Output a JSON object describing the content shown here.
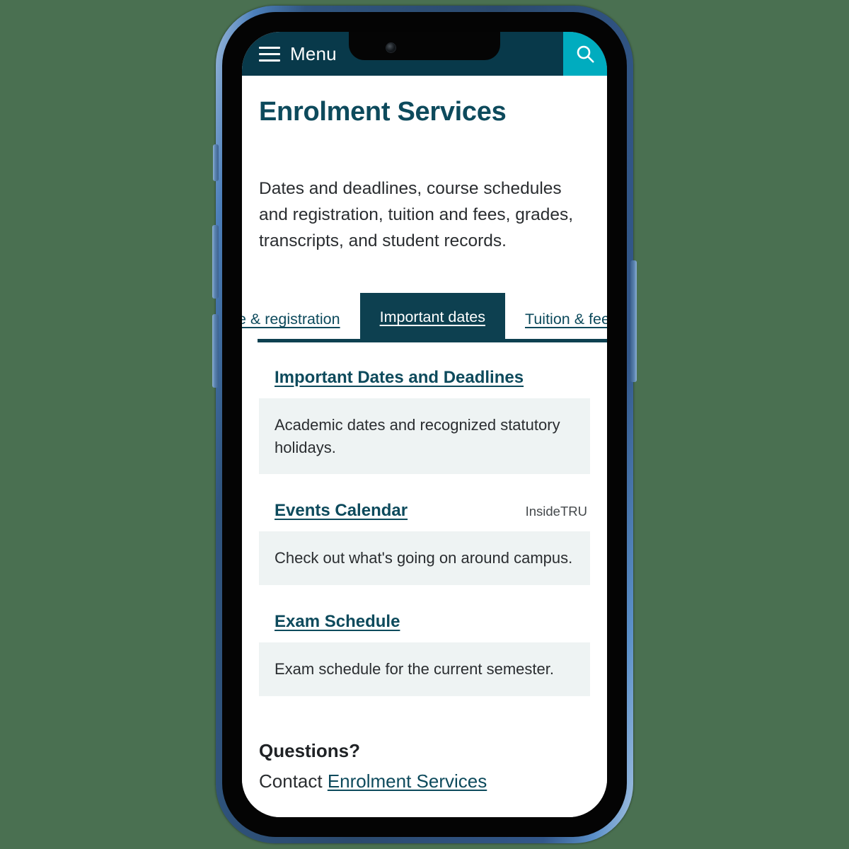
{
  "theme": {
    "page_background": "#4a7051",
    "header_background": "#08394a",
    "search_button_color": "#00acbf",
    "brand_dark_teal": "#0d4a5c",
    "active_tab_background": "#0d4050",
    "card_background": "#eef3f3",
    "body_text": "#2a2d30"
  },
  "header": {
    "menu_label": "Menu",
    "menu_icon": "hamburger-icon",
    "search_icon": "search-icon"
  },
  "page": {
    "title": "Enrolment Services",
    "intro": "Dates and deadlines, course schedules and registration, tuition and fees, grades, transcripts, and student records."
  },
  "tabs": [
    {
      "label": "e & registration",
      "active": false,
      "truncated": true
    },
    {
      "label": "Important dates",
      "active": true,
      "truncated": false
    },
    {
      "label": "Tuition & fees",
      "active": false,
      "truncated": false
    }
  ],
  "cards": [
    {
      "title": "Important Dates and Deadlines",
      "source": "",
      "description": "Academic dates and recognized statutory holidays."
    },
    {
      "title": "Events Calendar",
      "source": "InsideTRU",
      "description": "Check out what's going on around campus."
    },
    {
      "title": "Exam Schedule",
      "source": "",
      "description": "Exam schedule for the current semester."
    }
  ],
  "footer": {
    "heading": "Questions?",
    "contact_prefix": "Contact ",
    "contact_link": "Enrolment Services"
  },
  "device": {
    "type": "smartphone",
    "orientation": "portrait"
  }
}
